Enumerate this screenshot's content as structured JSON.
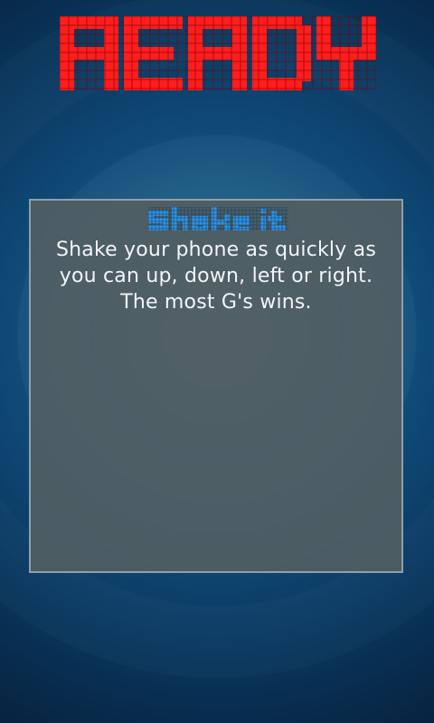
{
  "screen": {
    "title": "READY",
    "title_color": "#ff1d1d",
    "title_grid_color": "#8a0000",
    "background_color": "#0b3f6a"
  },
  "instructions": {
    "heading": "Shake it",
    "heading_color": "#2f95e6",
    "heading_grid_color": "#164d7c",
    "lines": [
      "Shake your phone as quickly as",
      "you can up, down, left or right.",
      "The most G's wins."
    ],
    "text_color": "#f2f5f7"
  }
}
